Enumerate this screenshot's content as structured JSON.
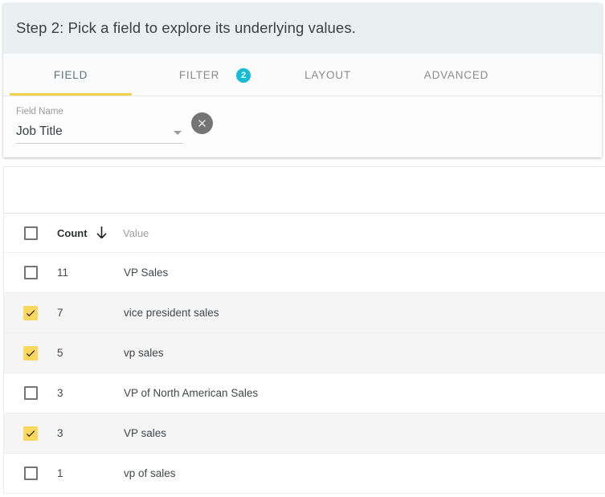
{
  "step": {
    "title": "Step 2: Pick a field to explore its underlying values."
  },
  "tabs": [
    {
      "label": "FIELD",
      "active": true,
      "badge": null
    },
    {
      "label": "FILTER",
      "active": false,
      "badge": "2"
    },
    {
      "label": "LAYOUT",
      "active": false,
      "badge": null
    },
    {
      "label": "ADVANCED",
      "active": false,
      "badge": null
    }
  ],
  "field": {
    "label": "Field Name",
    "value": "Job Title",
    "clear_icon": "close-circle-icon",
    "dropdown_icon": "chevron-down-icon"
  },
  "table": {
    "columns": [
      {
        "key": "count",
        "label": "Count",
        "sorted": true,
        "sort_direction": "descending"
      },
      {
        "key": "value",
        "label": "Value",
        "sorted": false,
        "sort_direction": null
      }
    ],
    "header_checkbox_checked": false,
    "rows": [
      {
        "checked": false,
        "count": "11",
        "value": "VP Sales"
      },
      {
        "checked": true,
        "count": "7",
        "value": "vice president sales"
      },
      {
        "checked": true,
        "count": "5",
        "value": "vp sales"
      },
      {
        "checked": false,
        "count": "3",
        "value": "VP of North American Sales"
      },
      {
        "checked": true,
        "count": "3",
        "value": "VP sales"
      },
      {
        "checked": false,
        "count": "1",
        "value": "vp of sales"
      }
    ]
  },
  "colors": {
    "header_bg": "#eaeff1",
    "accent_yellow": "#f2d24b",
    "checkbox_yellow": "#fbd85d",
    "badge_cyan": "#14bcd4",
    "active_tab_text": "#5c7382",
    "selected_row_bg": "#f5f5f5"
  }
}
